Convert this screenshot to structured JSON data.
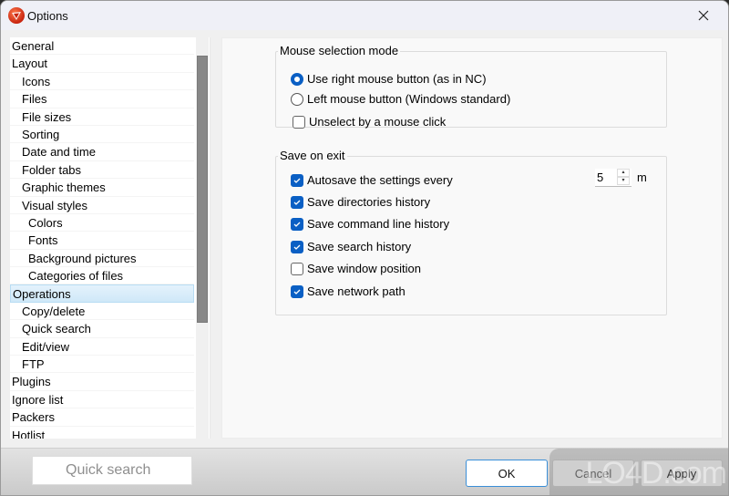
{
  "window": {
    "title": "Options",
    "close_label": "Close"
  },
  "tree": {
    "items": [
      {
        "label": "General",
        "level": 0
      },
      {
        "label": "Layout",
        "level": 0
      },
      {
        "label": "Icons",
        "level": 1
      },
      {
        "label": "Files",
        "level": 1
      },
      {
        "label": "File sizes",
        "level": 1
      },
      {
        "label": "Sorting",
        "level": 1
      },
      {
        "label": "Date and time",
        "level": 1
      },
      {
        "label": "Folder tabs",
        "level": 1
      },
      {
        "label": "Graphic themes",
        "level": 1
      },
      {
        "label": "Visual styles",
        "level": 1
      },
      {
        "label": "Colors",
        "level": 2
      },
      {
        "label": "Fonts",
        "level": 2
      },
      {
        "label": "Background pictures",
        "level": 2
      },
      {
        "label": "Categories of files",
        "level": 2
      },
      {
        "label": "Operations",
        "level": 0,
        "selected": true
      },
      {
        "label": "Copy/delete",
        "level": 1
      },
      {
        "label": "Quick search",
        "level": 1
      },
      {
        "label": "Edit/view",
        "level": 1
      },
      {
        "label": "FTP",
        "level": 1
      },
      {
        "label": "Plugins",
        "level": 0
      },
      {
        "label": "Ignore list",
        "level": 0
      },
      {
        "label": "Packers",
        "level": 0
      },
      {
        "label": "Hotlist",
        "level": 0
      }
    ]
  },
  "mouse_group": {
    "title": "Mouse selection mode",
    "radio_right": {
      "label": "Use right mouse button (as in NC)",
      "selected": true
    },
    "radio_left": {
      "label": "Left mouse button (Windows standard)",
      "selected": false
    },
    "unselect": {
      "label": "Unselect by a mouse click",
      "checked": false
    }
  },
  "save_group": {
    "title": "Save on exit",
    "autosave": {
      "label": "Autosave the settings every",
      "checked": true,
      "value": "5",
      "unit": "m"
    },
    "dir_history": {
      "label": "Save directories history",
      "checked": true
    },
    "cmd_history": {
      "label": "Save command line history",
      "checked": true
    },
    "search_history": {
      "label": "Save search history",
      "checked": true
    },
    "window_position": {
      "label": "Save window position",
      "checked": false
    },
    "network_path": {
      "label": "Save network path",
      "checked": true
    }
  },
  "footer": {
    "quick_search_placeholder": "Quick search",
    "ok_label": "OK",
    "cancel_label": "Cancel",
    "apply_label": "Apply",
    "watermark": "LO4D.com"
  },
  "colors": {
    "accent": "#0a5fc4",
    "selection_bg": "#cfe8f8"
  }
}
